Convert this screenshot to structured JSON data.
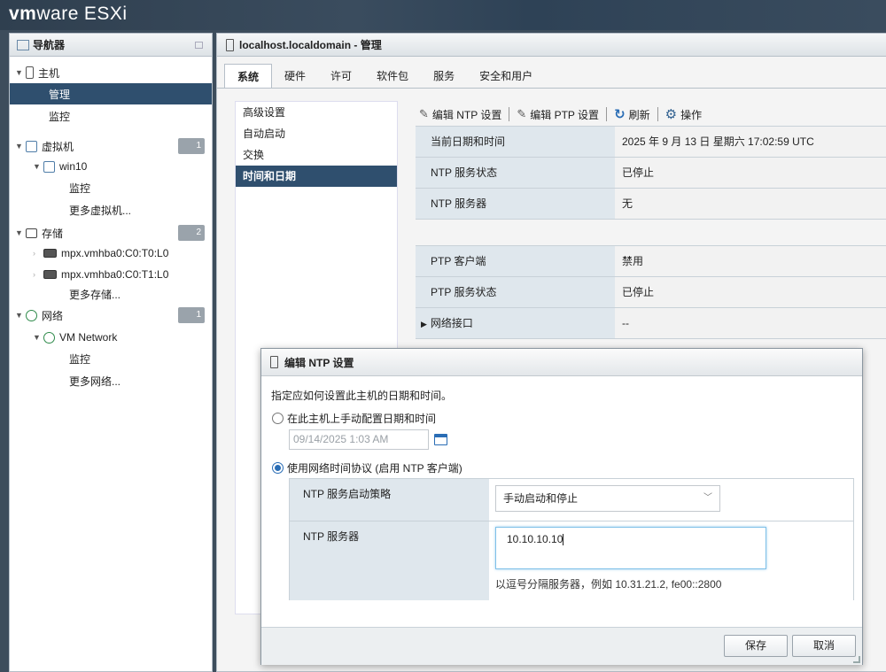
{
  "brand": {
    "vm": "vm",
    "ware": "ware",
    "esxi": "ESXi"
  },
  "navigator": {
    "title": "导航器",
    "items": [
      {
        "label": "主机"
      },
      {
        "label": "管理"
      },
      {
        "label": "监控"
      },
      {
        "label": "虚拟机",
        "badge": "1"
      },
      {
        "label": "win10"
      },
      {
        "label": "监控"
      },
      {
        "label": "更多虚拟机..."
      },
      {
        "label": "存储",
        "badge": "2"
      },
      {
        "label": "mpx.vmhba0:C0:T0:L0"
      },
      {
        "label": "mpx.vmhba0:C0:T1:L0"
      },
      {
        "label": "更多存储..."
      },
      {
        "label": "网络",
        "badge": "1"
      },
      {
        "label": "VM Network"
      },
      {
        "label": "监控"
      },
      {
        "label": "更多网络..."
      }
    ]
  },
  "main": {
    "title": "localhost.localdomain - 管理",
    "tabs": [
      "系统",
      "硬件",
      "许可",
      "软件包",
      "服务",
      "安全和用户"
    ],
    "subnav": [
      "高级设置",
      "自动启动",
      "交换",
      "时间和日期"
    ],
    "toolbar": {
      "edit_ntp": "编辑 NTP 设置",
      "edit_ptp": "编辑 PTP 设置",
      "refresh": "刷新",
      "actions": "操作"
    },
    "info1": [
      {
        "k": "当前日期和时间",
        "v": "2025 年 9 月 13 日 星期六 17:02:59 UTC"
      },
      {
        "k": "NTP 服务状态",
        "v": "已停止"
      },
      {
        "k": "NTP 服务器",
        "v": "无"
      }
    ],
    "info2": [
      {
        "k": "PTP 客户端",
        "v": "禁用"
      },
      {
        "k": "PTP 服务状态",
        "v": "已停止"
      },
      {
        "k": "网络接口",
        "v": "--"
      }
    ]
  },
  "dialog": {
    "title": "编辑 NTP 设置",
    "description": "指定应如何设置此主机的日期和时间。",
    "option_manual": "在此主机上手动配置日期和时间",
    "manual_datetime": "09/14/2025 1:03 AM",
    "option_ntp": "使用网络时间协议 (启用 NTP 客户端)",
    "policy_label": "NTP 服务启动策略",
    "policy_value": "手动启动和停止",
    "server_label": "NTP 服务器",
    "server_value": "10.10.10.10",
    "server_hint": "以逗号分隔服务器，例如 10.31.21.2, fe00::2800",
    "save": "保存",
    "cancel": "取消"
  }
}
